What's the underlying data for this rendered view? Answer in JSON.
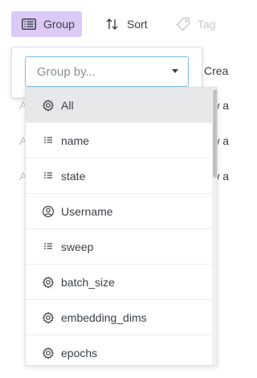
{
  "toolbar": {
    "group_label": "Group",
    "sort_label": "Sort",
    "tag_label": "Tag"
  },
  "table_bg": {
    "partial_header": "Crea",
    "rows": [
      {
        "left": "A",
        "right": "w a"
      },
      {
        "left": "A",
        "right": "w a"
      },
      {
        "left": "A",
        "right": "w a"
      }
    ]
  },
  "group_popup": {
    "placeholder": "Group by..."
  },
  "menu": {
    "items": [
      {
        "label": "All",
        "icon": "gear-icon",
        "active": true
      },
      {
        "label": "name",
        "icon": "list-icon"
      },
      {
        "label": "state",
        "icon": "list-icon"
      },
      {
        "label": "Username",
        "icon": "user-icon"
      },
      {
        "label": "sweep",
        "icon": "list-icon"
      },
      {
        "label": "batch_size",
        "icon": "gear-icon"
      },
      {
        "label": "embedding_dims",
        "icon": "gear-icon"
      },
      {
        "label": "epochs",
        "icon": "gear-icon"
      }
    ]
  }
}
